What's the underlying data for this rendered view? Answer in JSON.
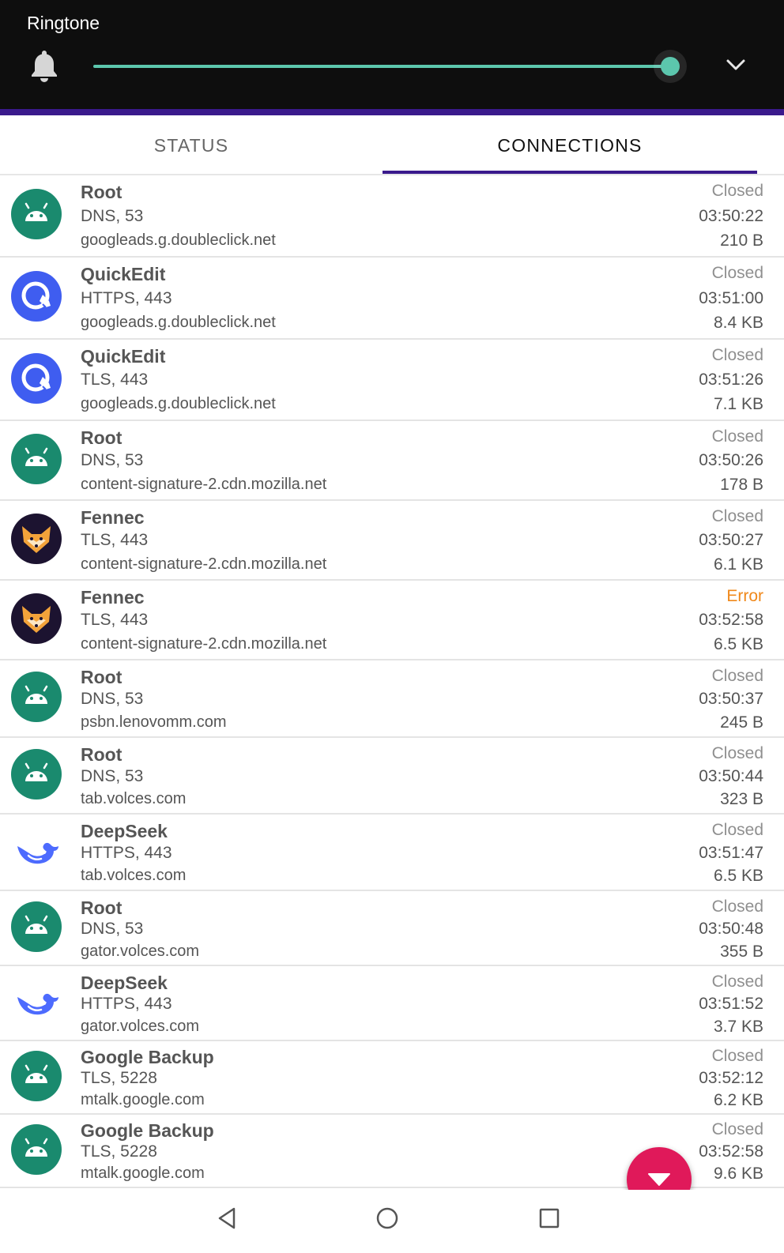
{
  "volume": {
    "title": "Ringtone",
    "level": 0.96,
    "accent_color": "#5cc6ad"
  },
  "tabs": [
    {
      "label": "STATUS",
      "selected": false
    },
    {
      "label": "CONNECTIONS",
      "selected": true
    }
  ],
  "connections": [
    {
      "app": "Root",
      "icon": "android-icon",
      "protocol": "DNS, 53",
      "host": "googleads.g.doubleclick.net",
      "status": "Closed",
      "time": "03:50:22",
      "size": "210 B"
    },
    {
      "app": "QuickEdit",
      "icon": "quickedit-icon",
      "protocol": "HTTPS, 443",
      "host": "googleads.g.doubleclick.net",
      "status": "Closed",
      "time": "03:51:00",
      "size": "8.4 KB"
    },
    {
      "app": "QuickEdit",
      "icon": "quickedit-icon",
      "protocol": "TLS, 443",
      "host": "googleads.g.doubleclick.net",
      "status": "Closed",
      "time": "03:51:26",
      "size": "7.1 KB"
    },
    {
      "app": "Root",
      "icon": "android-icon",
      "protocol": "DNS, 53",
      "host": "content-signature-2.cdn.mozilla.net",
      "status": "Closed",
      "time": "03:50:26",
      "size": "178 B"
    },
    {
      "app": "Fennec",
      "icon": "fennec-icon",
      "protocol": "TLS, 443",
      "host": "content-signature-2.cdn.mozilla.net",
      "status": "Closed",
      "time": "03:50:27",
      "size": "6.1 KB"
    },
    {
      "app": "Fennec",
      "icon": "fennec-icon",
      "protocol": "TLS, 443",
      "host": "content-signature-2.cdn.mozilla.net",
      "status": "Error",
      "time": "03:52:58",
      "size": "6.5 KB"
    },
    {
      "app": "Root",
      "icon": "android-icon",
      "protocol": "DNS, 53",
      "host": "psbn.lenovomm.com",
      "status": "Closed",
      "time": "03:50:37",
      "size": "245 B"
    },
    {
      "app": "Root",
      "icon": "android-icon",
      "protocol": "DNS, 53",
      "host": "tab.volces.com",
      "status": "Closed",
      "time": "03:50:44",
      "size": "323 B"
    },
    {
      "app": "DeepSeek",
      "icon": "deepseek-icon",
      "protocol": "HTTPS, 443",
      "host": "tab.volces.com",
      "status": "Closed",
      "time": "03:51:47",
      "size": "6.5 KB"
    },
    {
      "app": "Root",
      "icon": "android-icon",
      "protocol": "DNS, 53",
      "host": "gator.volces.com",
      "status": "Closed",
      "time": "03:50:48",
      "size": "355 B"
    },
    {
      "app": "DeepSeek",
      "icon": "deepseek-icon",
      "protocol": "HTTPS, 443",
      "host": "gator.volces.com",
      "status": "Closed",
      "time": "03:51:52",
      "size": "3.7 KB"
    },
    {
      "app": "Google Backup",
      "icon": "android-icon",
      "protocol": "TLS, 5228",
      "host": "mtalk.google.com",
      "status": "Closed",
      "time": "03:52:12",
      "size": "6.2 KB"
    },
    {
      "app": "Google Backup",
      "icon": "android-icon",
      "protocol": "TLS, 5228",
      "host": "mtalk.google.com",
      "status": "Closed",
      "time": "03:52:58",
      "size": "9.6 KB"
    }
  ],
  "colors": {
    "android_green": "#1a8a6e",
    "quickedit_blue": "#3f5df0",
    "fennec_dark": "#1c1330",
    "deepseek_blue": "#4d6bfe",
    "error_orange": "#f0881a",
    "fab_red": "#e0195a",
    "accent_purple": "#3a1a8c"
  },
  "fab": {
    "icon": "triangle-down-icon"
  },
  "navbar": {
    "icons": [
      "back-icon",
      "home-icon",
      "recents-icon"
    ]
  }
}
